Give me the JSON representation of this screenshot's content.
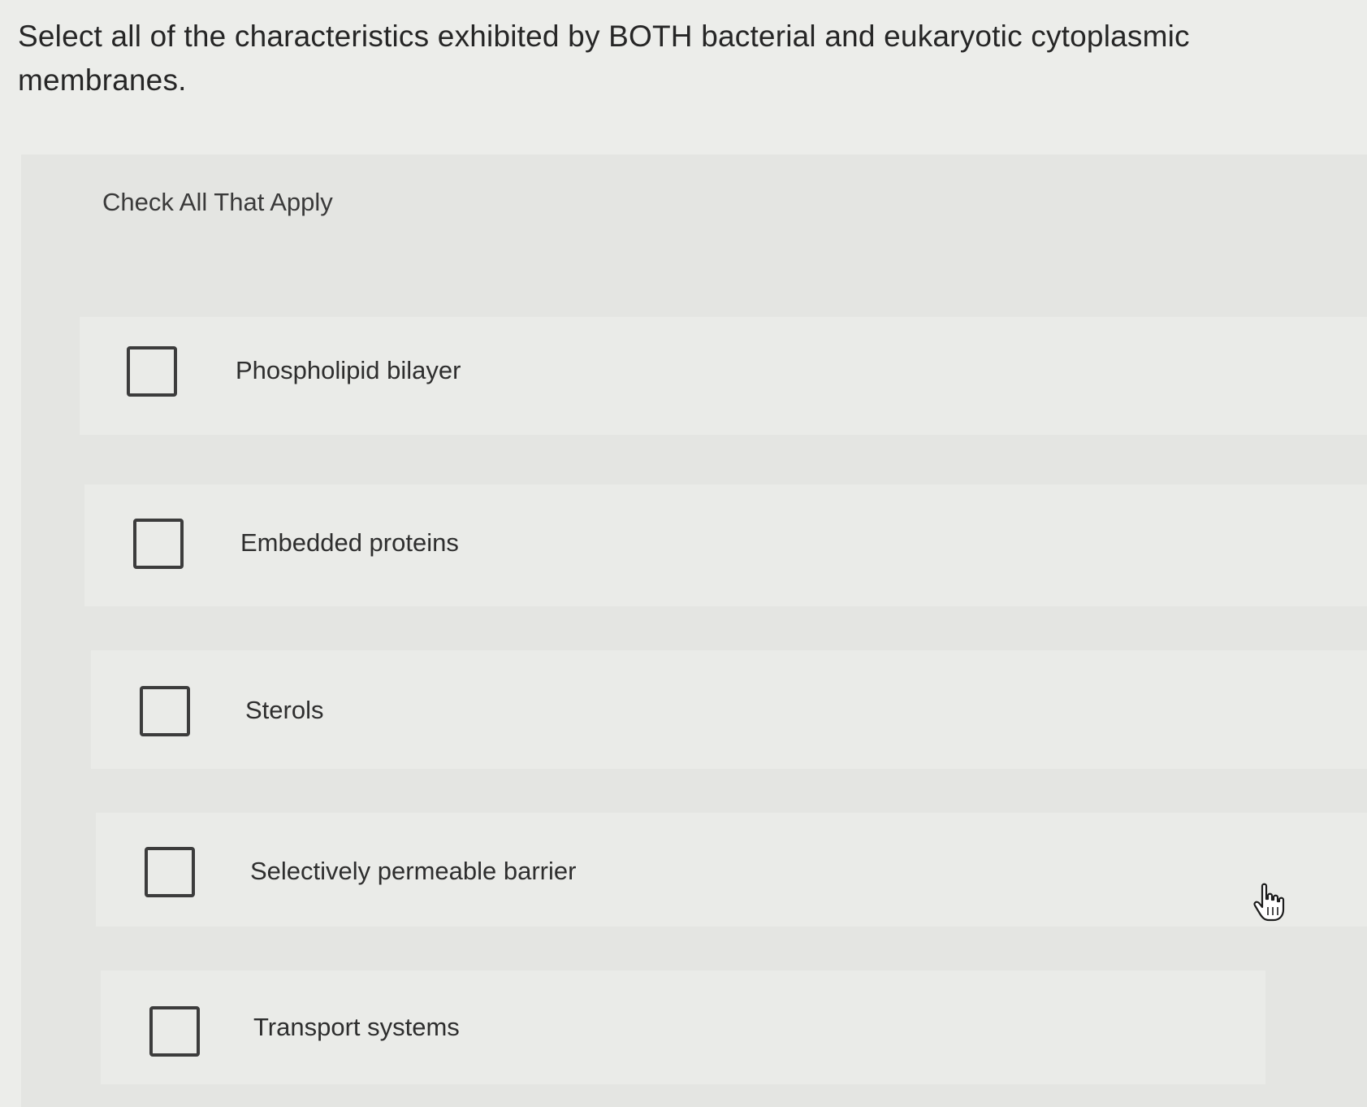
{
  "question": {
    "text": "Select all of the characteristics exhibited by BOTH bacterial and eukaryotic cytoplasmic membranes."
  },
  "instructions": "Check All That Apply",
  "choices": [
    {
      "label": "Phospholipid bilayer",
      "checked": false
    },
    {
      "label": "Embedded proteins",
      "checked": false
    },
    {
      "label": "Sterols",
      "checked": false
    },
    {
      "label": "Selectively permeable barrier",
      "checked": false
    },
    {
      "label": "Transport systems",
      "checked": false
    }
  ],
  "cursor": {
    "icon": "hand-pointer-icon"
  }
}
